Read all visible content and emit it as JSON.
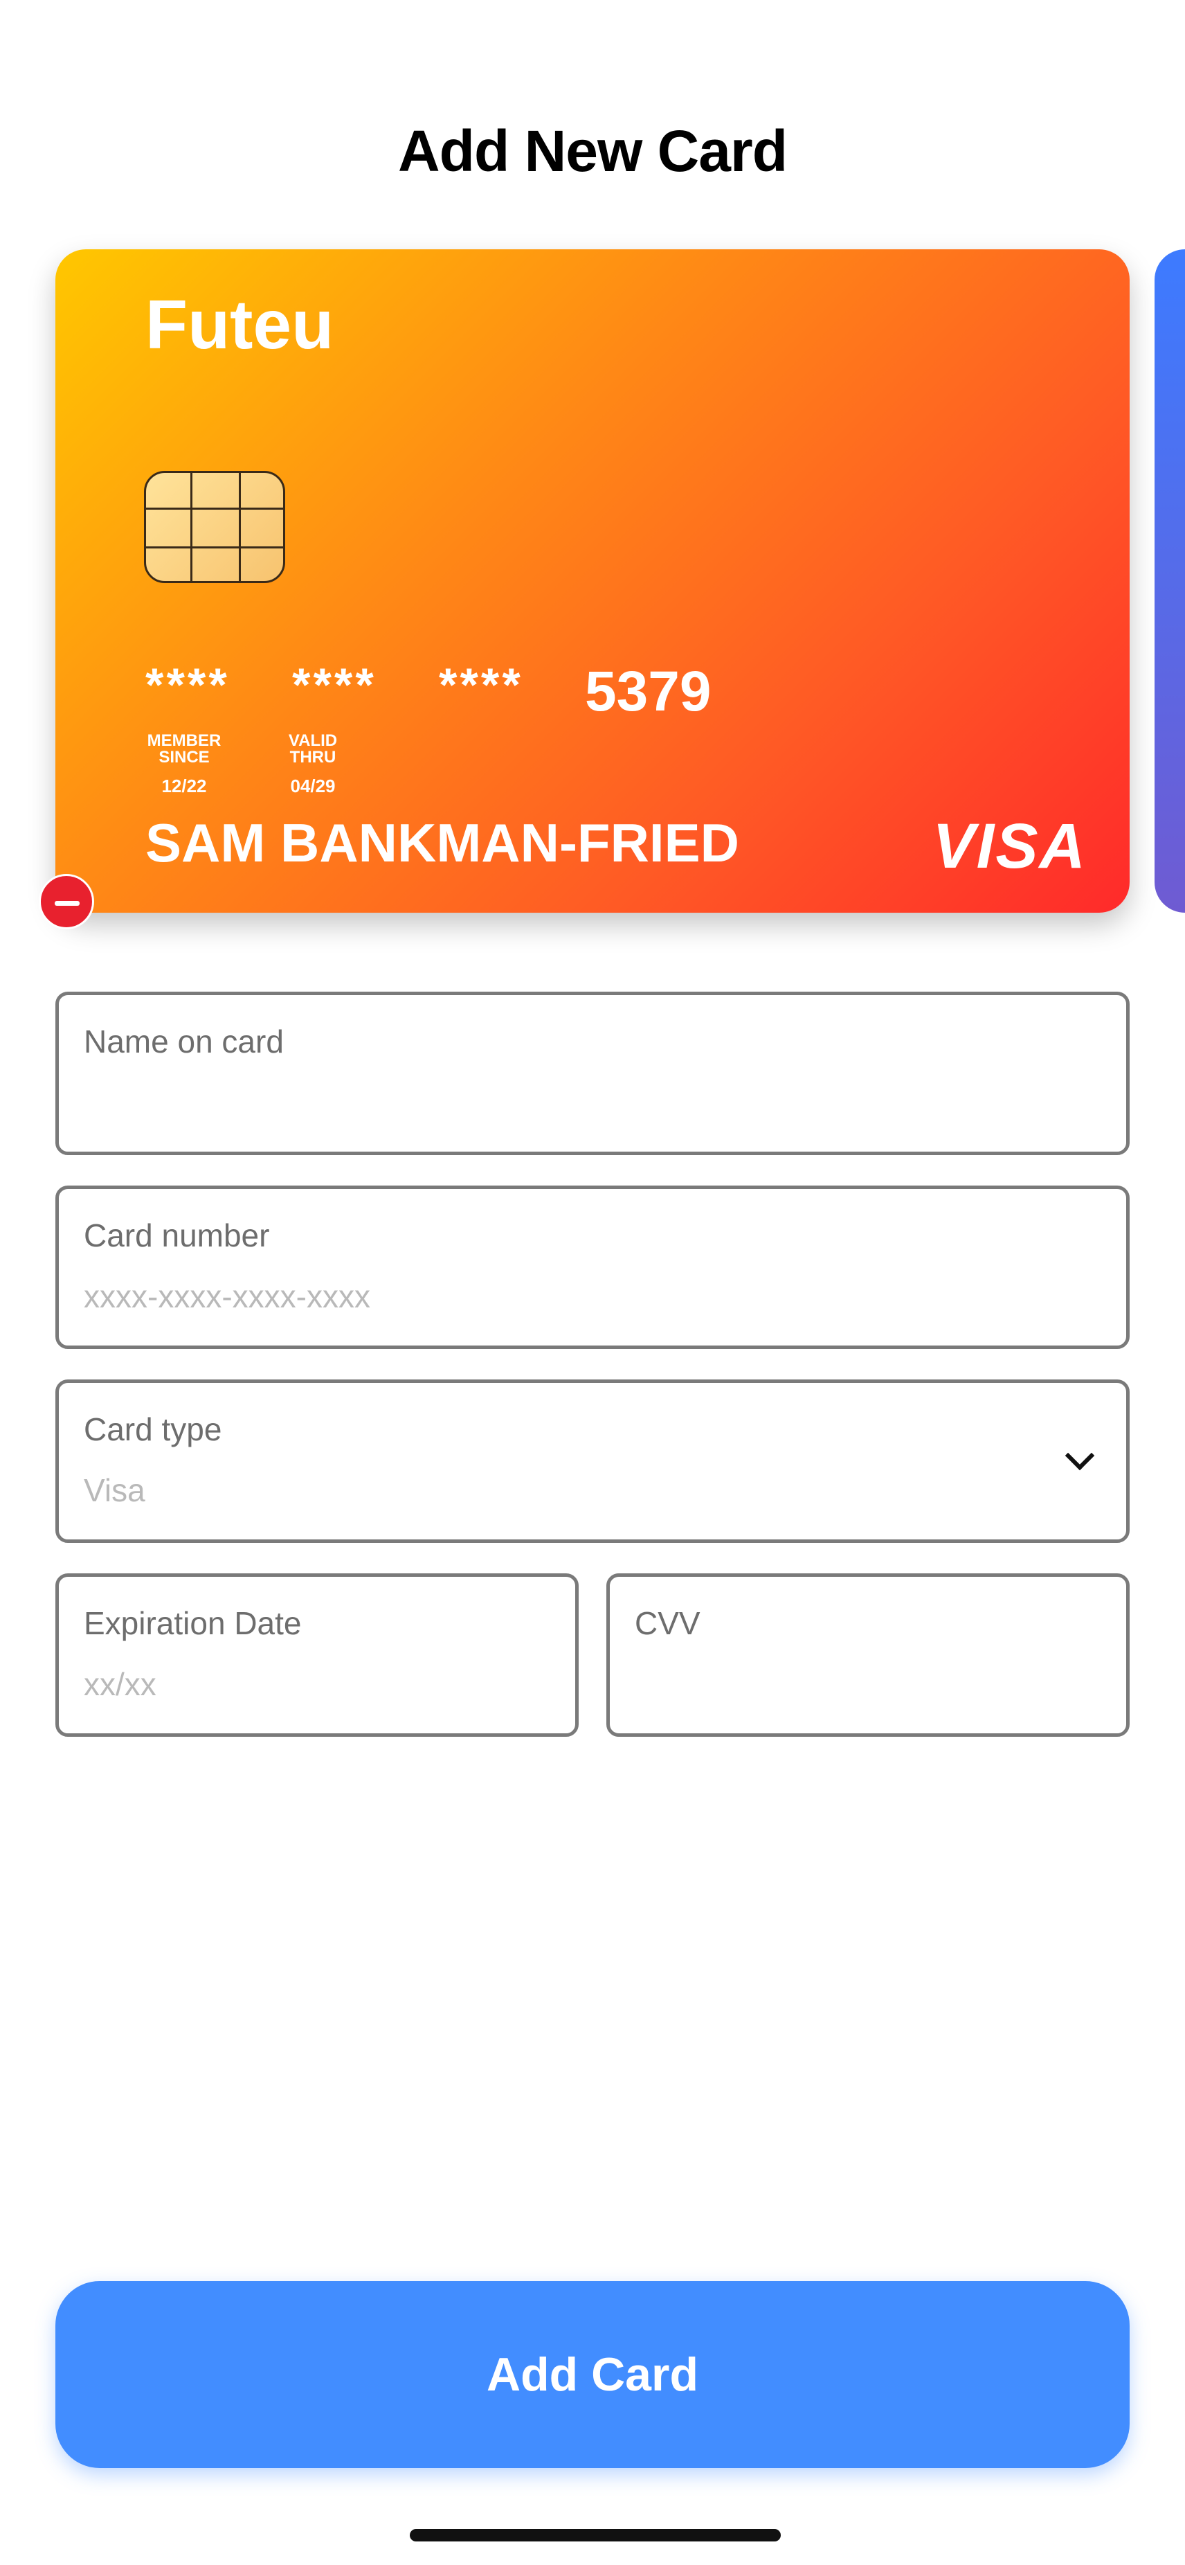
{
  "header": {
    "title": "Add New Card"
  },
  "card": {
    "brand": "Futeu",
    "masked_groups": [
      "****",
      "****",
      "****"
    ],
    "last4": "5379",
    "member_since_label": [
      "MEMBER",
      "SINCE"
    ],
    "member_since": "12/22",
    "valid_thru_label": [
      "VALID",
      "THRU"
    ],
    "valid_thru": "04/29",
    "holder": "SAM BANKMAN-FRIED",
    "network": "VISA",
    "gradient": [
      "#ffc700",
      "#ff8a15",
      "#ff2a2a"
    ]
  },
  "form": {
    "name": {
      "label": "Name on card",
      "placeholder": ""
    },
    "number": {
      "label": "Card number",
      "placeholder": "xxxx-xxxx-xxxx-xxxx"
    },
    "type": {
      "label": "Card type",
      "value": "Visa"
    },
    "expiry": {
      "label": "Expiration Date",
      "placeholder": "xx/xx"
    },
    "cvv": {
      "label": "CVV",
      "placeholder": ""
    }
  },
  "actions": {
    "add_label": "Add Card",
    "accent": "#428dff",
    "remove_color": "#e8212e"
  }
}
